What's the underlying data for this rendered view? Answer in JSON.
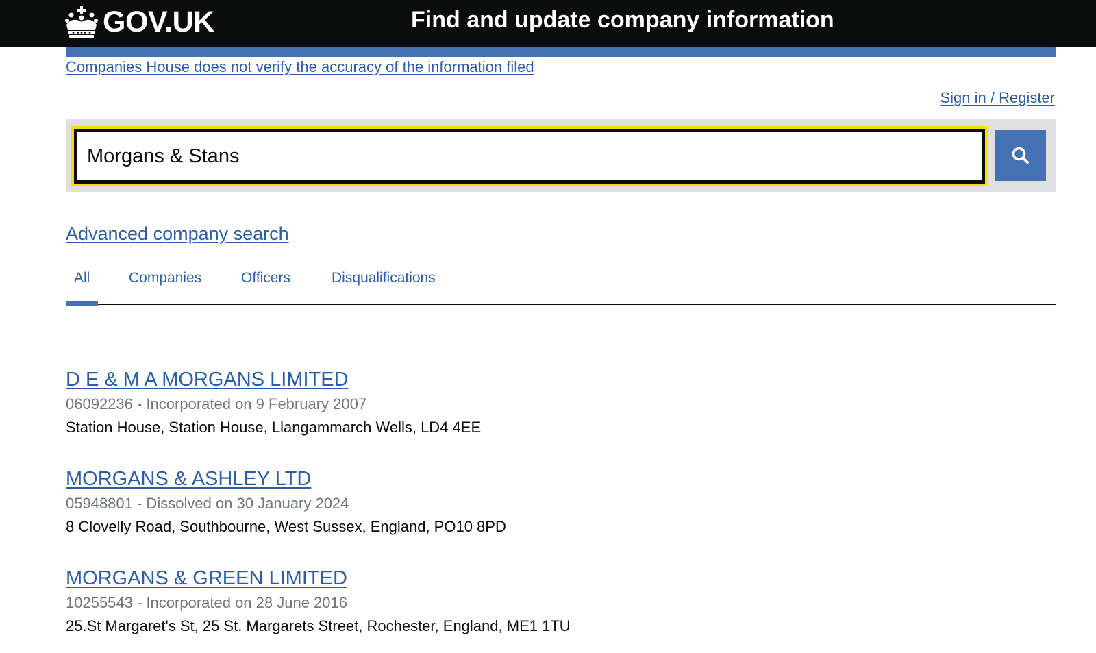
{
  "header": {
    "logo_text": "GOV.UK",
    "service_name": "Find and update company information"
  },
  "notice": {
    "disclaimer": "Companies House does not verify the accuracy of the information filed"
  },
  "account": {
    "signin": "Sign in / Register"
  },
  "search": {
    "value": "Morgans & Stans"
  },
  "advanced_search": "Advanced company search",
  "tabs": [
    {
      "label": "All",
      "active": true
    },
    {
      "label": "Companies",
      "active": false
    },
    {
      "label": "Officers",
      "active": false
    },
    {
      "label": "Disqualifications",
      "active": false
    }
  ],
  "results": [
    {
      "name": "D E & M A MORGANS LIMITED",
      "meta": "06092236 - Incorporated on 9 February 2007",
      "address": "Station House, Station House, Llangammarch Wells, LD4 4EE"
    },
    {
      "name": "MORGANS & ASHLEY LTD",
      "meta": "05948801 - Dissolved on 30 January 2024",
      "address": "8 Clovelly Road, Southbourne, West Sussex, England, PO10 8PD"
    },
    {
      "name": "MORGANS & GREEN LIMITED",
      "meta": "10255543 - Incorporated on 28 June 2016",
      "address": "25.St Margaret's St, 25 St. Margarets Street, Rochester, England, ME1 1TU"
    }
  ],
  "icons": {
    "logo": "crown-icon",
    "search": "search-icon"
  },
  "colors": {
    "header_bg": "#0b0c0c",
    "accent_blue": "#4472b5",
    "link": "#2a5eaa",
    "focus_yellow": "#ffdd00",
    "meta_grey": "#6f777b"
  }
}
